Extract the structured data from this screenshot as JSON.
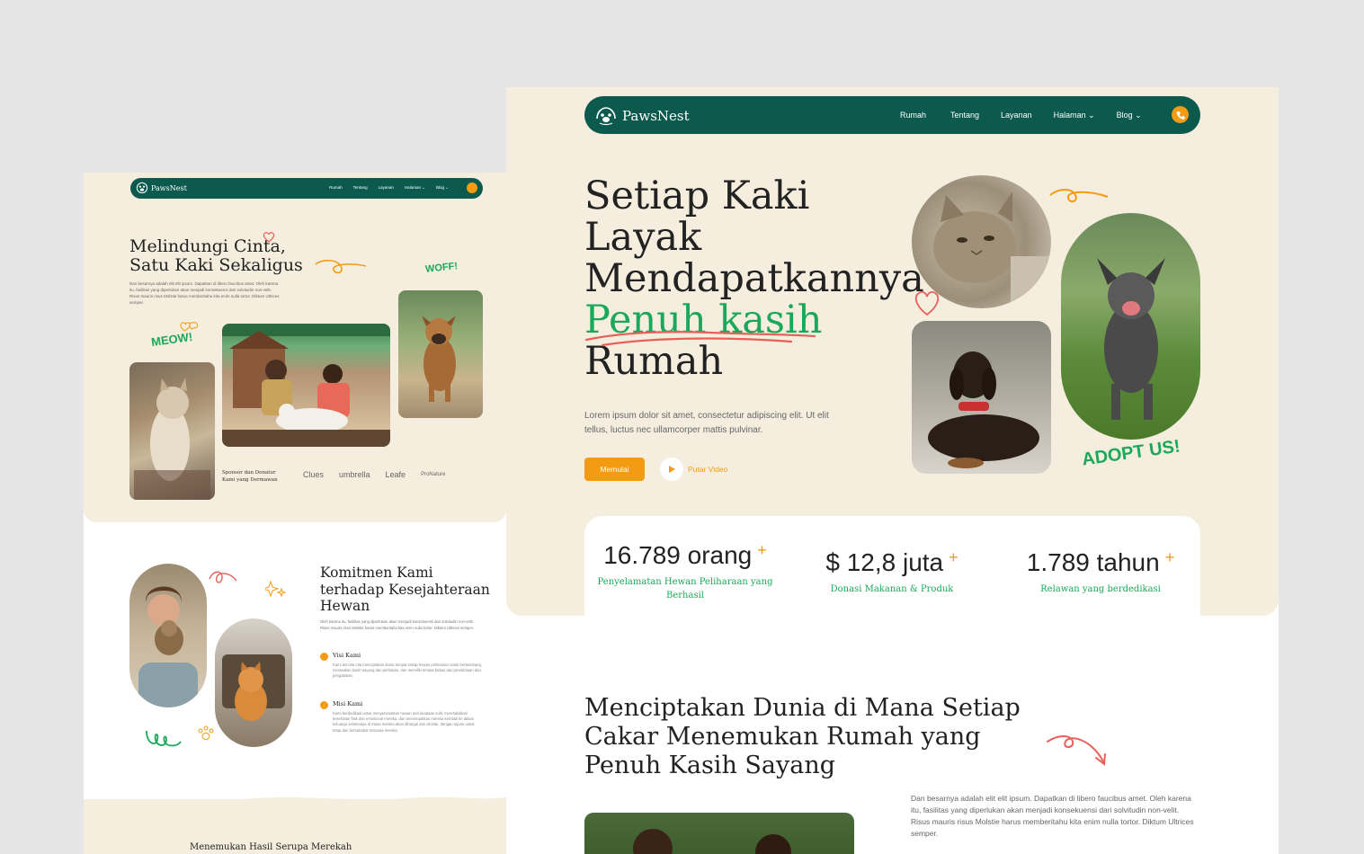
{
  "left": {
    "brand": "PawsNest",
    "nav": [
      "Rumah",
      "Tentang",
      "Layanan",
      "Halaman ⌄",
      "Blog ⌄"
    ],
    "hero_title": "Melindungi Cinta, Satu Kaki Sekaligus",
    "hero_text": "Dan besarnya adalah elit elit ipsum. Dapatkan di libero faucibus amet. Oleh karena itu, fasilitas yang diperlukan akan menjadi konsekuensi dari solvitudin non-velit. Risus mauris risus Molstie harus memberitahu kita enim nulla tortor. Diktum Ultrices semper.",
    "meow": "MEOW!",
    "woff": "WOFF!",
    "sponsor_label": "Sponsor dan Donatur Kami yang Dermawan",
    "brands": [
      "Clues",
      "umbrella",
      "Leafe",
      "ProNature"
    ],
    "commitment_title": "Komitmen Kami terhadap Kesejahteraan Hewan",
    "commitment_text": "Oleh karena itu, fasilitas yang diperlukan akan menjadi konsekuensi dari solvitudin non-velit. Risus mauris risus Molstie harus memberitahu kita enim nulla tortor. Diktum Ultrices semper.",
    "vision_title": "Visi Kami",
    "vision_text": "Kami berciita-cita menciptakan dunia tempat setiap hewan peliharaan untuk berkembang, merasakan kasih sayang dan perhatian, dan memiliki tempat bebas dari penderitaan dan pengabaian.",
    "mission_title": "Misi Kami",
    "mission_text": "Kami berdedikasi untuk menyelamatkan hewan dari keadaan sulit, merehabilitasi kesehatan fisik dan emosional mereka, dan menempatkan mereka kembali ke dalam keluarga selamanya di mana mereka akan dihargai dan dicintai, dengan tujuan untuk tetap dan bersahabat manusia mereka.",
    "bottom_heading": "Menemukan Hasil Serupa Merekah"
  },
  "right": {
    "brand": "PawsNest",
    "nav": [
      "Rumah",
      "Tentang",
      "Layanan",
      "Halaman ⌄",
      "Blog ⌄"
    ],
    "hero_lines": [
      "Setiap Kaki",
      "Layak",
      "Mendapatkannya"
    ],
    "hero_accent": "Penuh kasih",
    "hero_last": "Rumah",
    "hero_text": "Lorem ipsum dolor sit amet, consectetur adipiscing elit. Ut elit tellus, luctus nec ullamcorper mattis pulvinar.",
    "start_button": "Memulai",
    "play_label": "Putar Video",
    "adopt": "ADOPT US!",
    "stats": [
      {
        "value": "16.789 orang",
        "label": "Penyelamatan Hewan Peliharaan yang Berhasil"
      },
      {
        "value": "$ 12,8 juta",
        "label": "Donasi Makanan & Produk"
      },
      {
        "value": "1.789 tahun",
        "label": "Relawan yang berdedikasi"
      }
    ],
    "stat_plus": "+",
    "section_title": "Menciptakan Dunia di Mana Setiap Cakar Menemukan Rumah yang Penuh Kasih Sayang",
    "section_text": "Dan besarnya adalah elit elit ipsum. Dapatkan di libero faucibus amet. Oleh karena itu, fasilitas yang diperlukan akan menjadi konsekuensi dari solvitudin non-velit. Risus mauris risus Molstie harus memberitahu kita enim nulla tortor. Diktum Ultrices semper."
  },
  "colors": {
    "primary": "#0c5a4d",
    "accent": "#f29b13",
    "green": "#1aa85a",
    "cream": "#f5eede",
    "pink": "#e8605a"
  },
  "icons": [
    "paw-logo-icon",
    "phone-icon",
    "play-icon",
    "chevron-down-icon",
    "target-icon",
    "flag-icon",
    "heart-doodle-icon",
    "arrow-doodle-icon",
    "squiggle-doodle-icon",
    "sparkle-doodle-icon"
  ]
}
